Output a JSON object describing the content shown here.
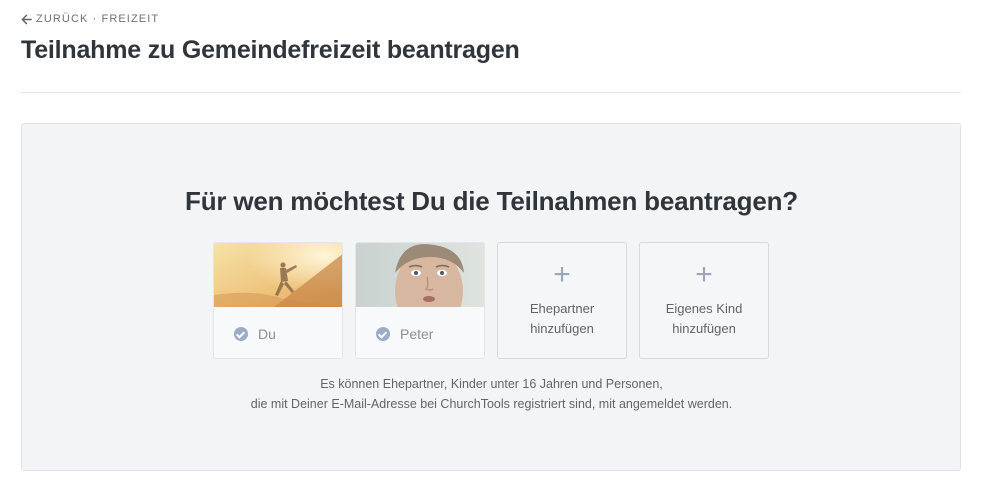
{
  "header": {
    "back_label": "ZURÜCK · FREIZEIT",
    "title": "Teilnahme zu Gemeindefreizeit beantragen"
  },
  "main": {
    "question": "Für wen möchtest Du die Teilnahmen beantragen?",
    "persons": [
      {
        "name": "Du",
        "selected": true,
        "icon": "check-circle-icon"
      },
      {
        "name": "Peter",
        "selected": true,
        "icon": "check-circle-icon"
      }
    ],
    "add_options": [
      {
        "label_line1": "Ehepartner",
        "label_line2": "hinzufügen",
        "icon": "plus-icon"
      },
      {
        "label_line1": "Eigenes Kind",
        "label_line2": "hinzufügen",
        "icon": "plus-icon"
      }
    ],
    "note_line1": "Es können Ehepartner, Kinder unter 16 Jahren und Personen,",
    "note_line2": "die mit Deiner E-Mail-Adresse bei ChurchTools registriert sind, mit angemeldet werden."
  },
  "colors": {
    "check": "#9aacc6",
    "plus": "#9aa7b6",
    "panel_bg": "#f3f4f6"
  }
}
